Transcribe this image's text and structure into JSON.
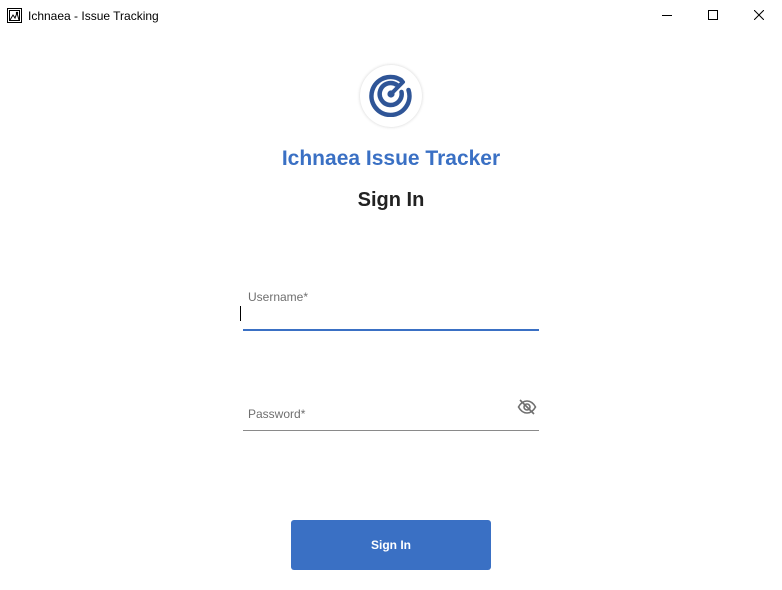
{
  "window": {
    "title": "Ichnaea - Issue Tracking",
    "icon": "app-window-icon",
    "controls": [
      "minimize-icon",
      "maximize-icon",
      "close-icon"
    ]
  },
  "logo": {
    "icon": "radar-target-icon",
    "color": "#2f5597"
  },
  "header": {
    "app_name": "Ichnaea Issue Tracker",
    "form_title": "Sign In"
  },
  "form": {
    "username": {
      "label": "Username*",
      "value": ""
    },
    "password": {
      "label": "Password*",
      "value": "",
      "toggle_icon": "eye-off-icon"
    },
    "submit_label": "Sign In"
  },
  "colors": {
    "accent": "#3a70c4",
    "heading_text": "#222222",
    "label_text": "#6f6f6f",
    "button_text": "#ffffff"
  }
}
